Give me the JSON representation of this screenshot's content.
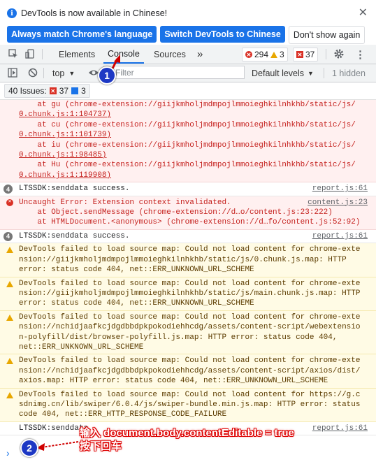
{
  "infobar": {
    "message": "DevTools is now available in Chinese!",
    "buttons": [
      "Always match Chrome's language",
      "Switch DevTools to Chinese",
      "Don't show again"
    ]
  },
  "tabs": {
    "elements": "Elements",
    "console": "Console",
    "sources": "Sources",
    "more": "»"
  },
  "counters": {
    "errors": "294",
    "warnings": "3",
    "issues": "37"
  },
  "toolbar": {
    "context": "top",
    "filter_placeholder": "Filter",
    "levels": "Default levels",
    "hidden": "1 hidden"
  },
  "issues": {
    "label": "40 Issues:",
    "errors": "37",
    "messages": "3"
  },
  "stack_top": [
    "    at gu (chrome-extension://giijkmholjmdmpojlmmoieghkilnhkhb/static/js/",
    "0.chunk.js:1:104737)",
    "    at cu (chrome-extension://giijkmholjmdmpojlmmoieghkilnhkhb/static/js/",
    "0.chunk.js:1:101739)",
    "    at iu (chrome-extension://giijkmholjmdmpojlmmoieghkilnhkhb/static/js/",
    "0.chunk.js:1:98485)",
    "    at Hu (chrome-extension://giijkmholjmdmpojlmmoieghkilnhkhb/static/js/",
    "0.chunk.js:1:119908)"
  ],
  "log1": {
    "count": "4",
    "text": "LTSSDK:senddata success.",
    "source": "report.js:61"
  },
  "err1": {
    "line1": "Uncaught Error: Extension context invalidated.",
    "source": "content.js:23",
    "line2": "    at Object.sendMessage (chrome-extension://d…o/content.js:23:222)",
    "line3": "    at HTMLDocument.<anonymous> (chrome-extension://d…fo/content.js:52:92)"
  },
  "log2": {
    "count": "4",
    "text": "LTSSDK:senddata success.",
    "source": "report.js:61"
  },
  "warnings": [
    {
      "lines": [
        "DevTools failed to load source map: Could not load content for chrome-exte",
        "nsion://giijkmholjmdmpojlmmoieghkilnhkhb/static/js/0.chunk.js.map: HTTP",
        "error: status code 404, net::ERR_UNKNOWN_URL_SCHEME"
      ]
    },
    {
      "lines": [
        "DevTools failed to load source map: Could not load content for chrome-exte",
        "nsion://giijkmholjmdmpojlmmoieghkilnhkhb/static/js/main.chunk.js.map: HTTP",
        "error: status code 404, net::ERR_UNKNOWN_URL_SCHEME"
      ]
    },
    {
      "lines": [
        "DevTools failed to load source map: Could not load content for chrome-exte",
        "nsion://nchidjaafkcjdgdbbdpkpokodiehhcdg/assets/content-script/webextensio",
        "n-polyfill/dist/browser-polyfill.js.map: HTTP error: status code 404,",
        "net::ERR_UNKNOWN_URL_SCHEME"
      ]
    },
    {
      "lines": [
        "DevTools failed to load source map: Could not load content for chrome-exte",
        "nsion://nchidjaafkcjdgdbbdpkpokodiehhcdg/assets/content-script/axios/dist/",
        "axios.map: HTTP error: status code 404, net::ERR_UNKNOWN_URL_SCHEME"
      ]
    },
    {
      "lines": [
        "DevTools failed to load source map: Could not load content for https://g.c",
        "sdnimg.cn/lib/swiper/6.0.4/js/swiper-bundle.min.js.map: HTTP error: status",
        "code 404, net::ERR_HTTP_RESPONSE_CODE_FAILURE"
      ]
    }
  ],
  "log3": {
    "text": "LTSSDK:senddata",
    "source": "report.js:61"
  },
  "prompt": "›",
  "annotations": {
    "step1": "1",
    "step2": "2",
    "instruction_line1": "输入 document.body.contentEditable = true",
    "instruction_line2": "按下回车"
  },
  "colors": {
    "accent": "#1a73e8",
    "error": "#d93025",
    "warning": "#e8a700",
    "annotation": "#1d38c4",
    "annotation_arrow": "#d00000"
  }
}
